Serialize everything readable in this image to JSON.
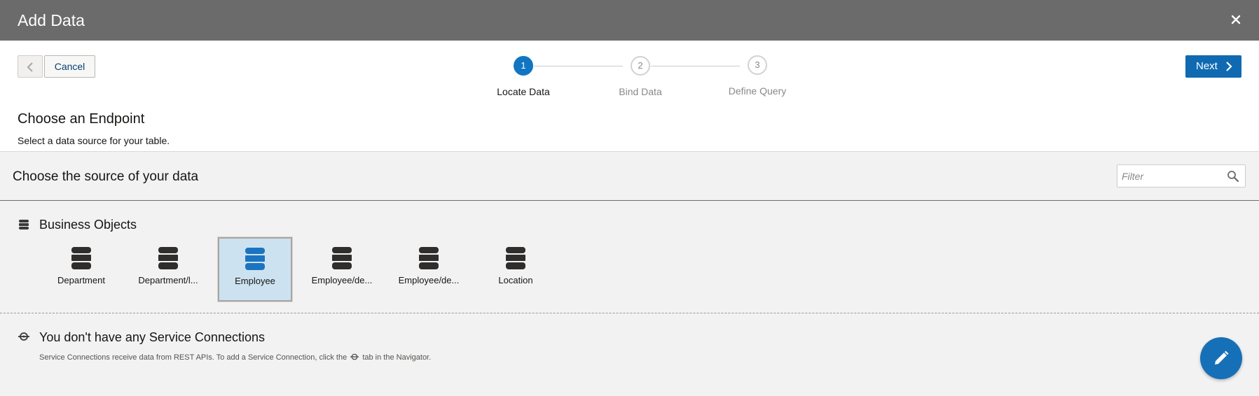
{
  "dialog": {
    "title": "Add Data"
  },
  "train": {
    "cancel_label": "Cancel",
    "next_label": "Next",
    "steps": [
      {
        "number": "1",
        "label": "Locate Data",
        "state": "active"
      },
      {
        "number": "2",
        "label": "Bind Data",
        "state": "inactive"
      },
      {
        "number": "3",
        "label": "Define Query",
        "state": "inactive"
      }
    ]
  },
  "endpoint": {
    "title": "Choose an Endpoint",
    "subtitle": "Select a data source for your table."
  },
  "source": {
    "title": "Choose the source of your data",
    "filter_placeholder": "Filter"
  },
  "business_objects": {
    "title": "Business Objects",
    "items": [
      {
        "label": "Department",
        "selected": false
      },
      {
        "label": "Department/l...",
        "selected": false
      },
      {
        "label": "Employee",
        "selected": true
      },
      {
        "label": "Employee/de...",
        "selected": false
      },
      {
        "label": "Employee/de...",
        "selected": false
      },
      {
        "label": "Location",
        "selected": false
      }
    ]
  },
  "service_connections": {
    "title": "You don't have any Service Connections",
    "desc_before": "Service Connections receive data from REST APIs. To add a Service Connection, click the",
    "desc_after": "tab in the Navigator."
  },
  "colors": {
    "titlebar": "#6b6b6b",
    "accent": "#0f6ab2",
    "selected_tile": "#cde2f0",
    "panel": "#f2f2f2"
  },
  "icons": {
    "close": "close-icon",
    "back": "chevron-left-icon",
    "next": "chevron-right-icon",
    "search": "search-icon",
    "database": "database-icon",
    "service": "service-connection-icon",
    "edit": "pencil-icon"
  }
}
